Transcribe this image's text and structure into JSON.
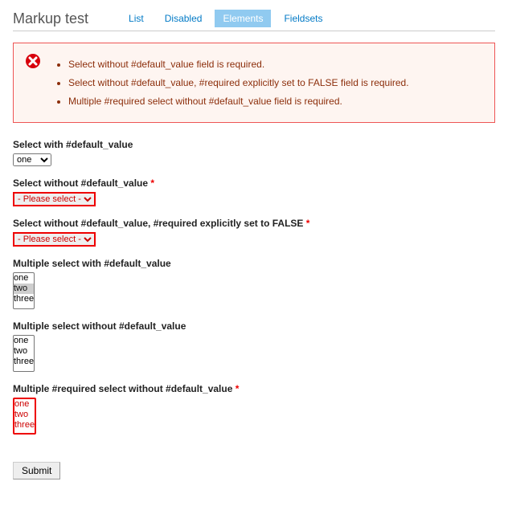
{
  "header": {
    "title": "Markup test",
    "tabs": [
      {
        "label": "List",
        "active": false
      },
      {
        "label": "Disabled",
        "active": false
      },
      {
        "label": "Elements",
        "active": true
      },
      {
        "label": "Fieldsets",
        "active": false
      }
    ]
  },
  "errors": [
    "Select without #default_value field is required.",
    "Select without #default_value, #required explicitly set to FALSE field is required.",
    "Multiple #required select without #default_value field is required."
  ],
  "options": {
    "please_select": "- Please select -",
    "one": "one",
    "two": "two",
    "three": "three"
  },
  "fields": {
    "f1": {
      "label": "Select with #default_value",
      "required": false,
      "error": false,
      "multiple": false,
      "selected": "one"
    },
    "f2": {
      "label": "Select without #default_value",
      "required": true,
      "error": true,
      "multiple": false,
      "selected": "please_select"
    },
    "f3": {
      "label": "Select without #default_value, #required explicitly set to FALSE",
      "required": true,
      "error": true,
      "multiple": false,
      "selected": "please_select"
    },
    "f4": {
      "label": "Multiple select with #default_value",
      "required": false,
      "error": false,
      "multiple": true,
      "selected": "two"
    },
    "f5": {
      "label": "Multiple select without #default_value",
      "required": false,
      "error": false,
      "multiple": true,
      "selected": null
    },
    "f6": {
      "label": "Multiple #required select without #default_value",
      "required": true,
      "error": true,
      "multiple": true,
      "selected": null
    }
  },
  "submit": {
    "label": "Submit"
  },
  "required_marker": "*"
}
